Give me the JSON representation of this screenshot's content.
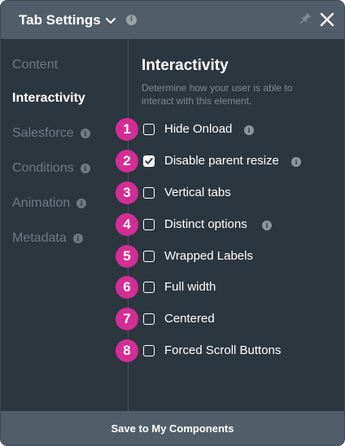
{
  "header": {
    "title": "Tab Settings",
    "info_glyph": "i",
    "icons": [
      "chevron-down-icon",
      "info-icon",
      "pin-icon",
      "close-icon"
    ]
  },
  "sidebar": {
    "items": [
      {
        "label": "Content",
        "active": false,
        "has_info": false
      },
      {
        "label": "Interactivity",
        "active": true,
        "has_info": false
      },
      {
        "label": "Salesforce",
        "active": false,
        "has_info": true
      },
      {
        "label": "Conditions",
        "active": false,
        "has_info": true
      },
      {
        "label": "Animation",
        "active": false,
        "has_info": true
      },
      {
        "label": "Metadata",
        "active": false,
        "has_info": true
      }
    ]
  },
  "section": {
    "title": "Interactivity",
    "description": "Determine how your user is able to interact with this element."
  },
  "options": [
    {
      "badge": "1",
      "label": "Hide Onload",
      "checked": false,
      "has_info": true
    },
    {
      "badge": "2",
      "label": "Disable parent resize",
      "checked": true,
      "has_info": true
    },
    {
      "badge": "3",
      "label": "Vertical tabs",
      "checked": false,
      "has_info": false
    },
    {
      "badge": "4",
      "label": "Distinct options",
      "checked": false,
      "has_info": true
    },
    {
      "badge": "5",
      "label": "Wrapped Labels",
      "checked": false,
      "has_info": false
    },
    {
      "badge": "6",
      "label": "Full width",
      "checked": false,
      "has_info": false
    },
    {
      "badge": "7",
      "label": "Centered",
      "checked": false,
      "has_info": false
    },
    {
      "badge": "8",
      "label": "Forced Scroll Buttons",
      "checked": false,
      "has_info": false
    }
  ],
  "footer": {
    "save_label": "Save to My Components"
  },
  "colors": {
    "panel_bg": "#2c363f",
    "header_bg": "#515e69",
    "badge_accent": "#d42d96",
    "inactive_text": "#6d7a85"
  }
}
